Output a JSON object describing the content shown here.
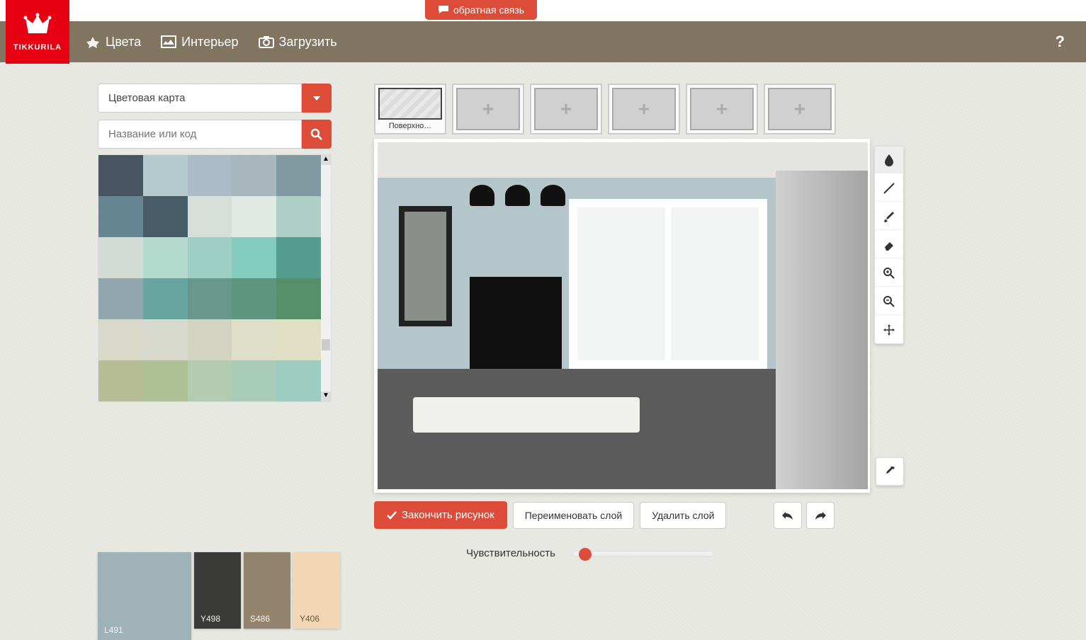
{
  "brand": "TIKKURILA",
  "feedback_label": "обратная связь",
  "nav": {
    "colors": "Цвета",
    "interior": "Интерьер",
    "upload": "Загрузить",
    "help": "?"
  },
  "color_panel": {
    "dropdown_label": "Цветовая карта",
    "search_placeholder": "Название или код",
    "swatches": [
      "#475563",
      "#b4cacf",
      "#abbcc8",
      "#a8b6bd",
      "#819aa2",
      "#668593",
      "#465c67",
      "#d6e0d9",
      "#dfeae4",
      "#afcec5",
      "#d1dcd5",
      "#b3dacc",
      "#9ecfc5",
      "#83ccbe",
      "#579d8e",
      "#92a7ad",
      "#68a4a0",
      "#68988c",
      "#5d9680",
      "#559068",
      "#d9d9c9",
      "#d8dacd",
      "#d3d4c2",
      "#dedec9",
      "#e1e0c7",
      "#b7bd94",
      "#aec096",
      "#b3cbb0",
      "#a8ccb8",
      "#9dccc0"
    ]
  },
  "selected_colors": [
    {
      "code": "L491",
      "hex": "#9eb2b7",
      "light": false,
      "large": true
    },
    {
      "code": "Y498",
      "hex": "#3a3a38",
      "light": false,
      "large": false
    },
    {
      "code": "S486",
      "hex": "#94846d",
      "light": false,
      "large": false
    },
    {
      "code": "Y406",
      "hex": "#f3d7b5",
      "light": true,
      "large": false
    }
  ],
  "thumbs": {
    "active_label": "Поверхно…",
    "empty_count": 5
  },
  "actions": {
    "finish": "Закончить рисунок",
    "rename": "Переименовать слой",
    "delete": "Удалить слой"
  },
  "sensitivity_label": "Чувствительность",
  "tools": [
    "drop",
    "line",
    "brush",
    "eraser",
    "zoom-in",
    "zoom-out",
    "move"
  ],
  "accent": "#dd4c39"
}
